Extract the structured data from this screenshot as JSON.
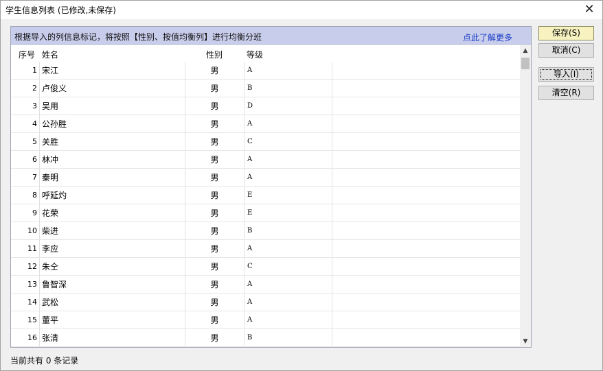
{
  "window": {
    "title": "学生信息列表 (已修改,未保存)",
    "close_glyph": "✕"
  },
  "info_bar": {
    "text": "根据导入的列信息标记，将按照【性别、按值均衡列】进行均衡分班",
    "link": "点此了解更多"
  },
  "table": {
    "headers": {
      "idx": "序号",
      "name": "姓名",
      "sex": "性别",
      "grade": "等级"
    },
    "rows": [
      {
        "idx": "1",
        "name": "宋江",
        "sex": "男",
        "grade": "A"
      },
      {
        "idx": "2",
        "name": "卢俊义",
        "sex": "男",
        "grade": "B"
      },
      {
        "idx": "3",
        "name": "吴用",
        "sex": "男",
        "grade": "D"
      },
      {
        "idx": "4",
        "name": "公孙胜",
        "sex": "男",
        "grade": "A"
      },
      {
        "idx": "5",
        "name": "关胜",
        "sex": "男",
        "grade": "C"
      },
      {
        "idx": "6",
        "name": "林冲",
        "sex": "男",
        "grade": "A"
      },
      {
        "idx": "7",
        "name": "秦明",
        "sex": "男",
        "grade": "A"
      },
      {
        "idx": "8",
        "name": "呼延灼",
        "sex": "男",
        "grade": "E"
      },
      {
        "idx": "9",
        "name": "花荣",
        "sex": "男",
        "grade": "E"
      },
      {
        "idx": "10",
        "name": "柴进",
        "sex": "男",
        "grade": "B"
      },
      {
        "idx": "11",
        "name": "李应",
        "sex": "男",
        "grade": "A"
      },
      {
        "idx": "12",
        "name": "朱仝",
        "sex": "男",
        "grade": "C"
      },
      {
        "idx": "13",
        "name": "鲁智深",
        "sex": "男",
        "grade": "A"
      },
      {
        "idx": "14",
        "name": "武松",
        "sex": "男",
        "grade": "A"
      },
      {
        "idx": "15",
        "name": "董平",
        "sex": "男",
        "grade": "A"
      },
      {
        "idx": "16",
        "name": "张清",
        "sex": "男",
        "grade": "B"
      }
    ]
  },
  "buttons": {
    "save": "保存(S)",
    "cancel": "取消(C)",
    "import": "导入(I)",
    "clear": "清空(R)"
  },
  "status": "当前共有 0 条记录",
  "icons": {
    "scroll_up": "chevron-up-icon",
    "scroll_down": "chevron-down-icon",
    "close": "close-icon"
  },
  "colors": {
    "info_bar_bg": "#c8cdeb",
    "link": "#1a3ec8",
    "save_button_bg": "#f7f2c0"
  }
}
